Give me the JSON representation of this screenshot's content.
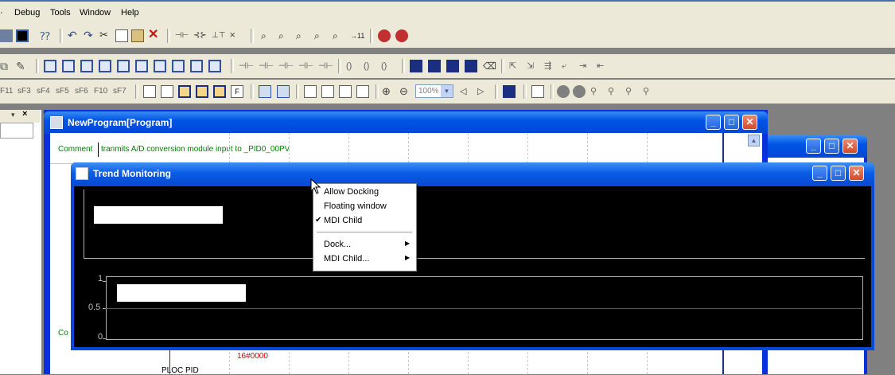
{
  "menubar": {
    "items": [
      "Debug",
      "Tools",
      "Window",
      "Help"
    ]
  },
  "program_window": {
    "title": "NewProgram[Program]",
    "comment_label": "Comment",
    "comment_text": "tranmits A/D conversion module input to _PID0_00PV",
    "side_label": "Co",
    "value_text": "16#0000",
    "bottom_text": "PLOC  PID"
  },
  "trend_window": {
    "title": "Trend Monitoring",
    "y_axis_ticks": [
      "1",
      "0.5",
      "0"
    ]
  },
  "context_menu": {
    "items": [
      {
        "label": "Allow Docking",
        "checked": false,
        "submenu": false
      },
      {
        "label": "Floating window",
        "checked": false,
        "submenu": false
      },
      {
        "label": "MDI Child",
        "checked": true,
        "submenu": false
      },
      {
        "label": "Dock...",
        "checked": false,
        "submenu": true
      },
      {
        "label": "MDI Child...",
        "checked": false,
        "submenu": true
      }
    ]
  },
  "toolbar": {
    "zoom_value": "100%"
  },
  "colors": {
    "xp_blue": "#0055e5",
    "menu_bg": "#ece9d8",
    "comment_green": "#008000",
    "value_red": "#cc0000",
    "trend_bg": "#000000"
  }
}
